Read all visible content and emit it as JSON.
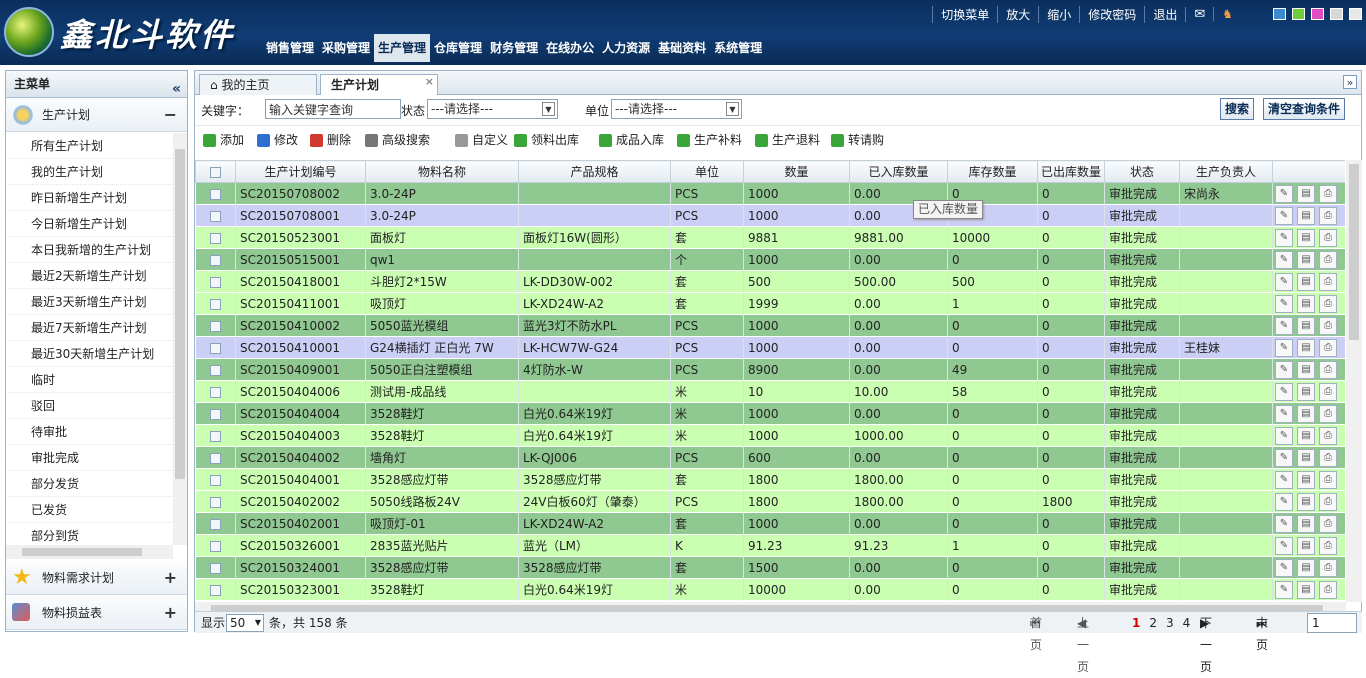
{
  "app": {
    "logo_text": "鑫北斗软件"
  },
  "top_nav": [
    "销售管理",
    "采购管理",
    "生产管理",
    "仓库管理",
    "财务管理",
    "在线办公",
    "人力资源",
    "基础资料",
    "系统管理"
  ],
  "top_utils": {
    "switch_menu": "切换菜单",
    "zoom_in": "放大",
    "zoom_out": "缩小",
    "change_password": "修改密码",
    "logout": "退出"
  },
  "theme_colors": [
    "#3c8ad0",
    "#6ccc3c",
    "#e04cc0",
    "#d8d8d8",
    "#e8e8e8"
  ],
  "sidebar": {
    "title": "主菜单",
    "collapse_glyph": "«",
    "groups": [
      {
        "label": "生产计划",
        "state": "−"
      },
      {
        "label": "物料需求计划",
        "state": "+"
      },
      {
        "label": "物料损益表",
        "state": "+"
      }
    ],
    "items": [
      "所有生产计划",
      "我的生产计划",
      "昨日新增生产计划",
      "今日新增生产计划",
      "本日我新增的生产计划",
      "最近2天新增生产计划",
      "最近3天新增生产计划",
      "最近7天新增生产计划",
      "最近30天新增生产计划",
      "临时",
      "驳回",
      "待审批",
      "审批完成",
      "部分发货",
      "已发货",
      "部分到货"
    ]
  },
  "tabs": [
    "我的主页",
    "生产计划"
  ],
  "search": {
    "keyword_label": "关键字：",
    "keyword_value": "输入关键字查询",
    "status_label": "状态",
    "status_value": "---请选择---",
    "unit_label": "单位",
    "unit_value": "---请选择---",
    "search_btn": "搜索",
    "clear_btn": "清空查询条件"
  },
  "toolbar": [
    {
      "label": "添加",
      "color": "#3aa63a"
    },
    {
      "label": "修改",
      "color": "#2f6fd0"
    },
    {
      "label": "删除",
      "color": "#d03a2f"
    },
    {
      "label": "高级搜索",
      "color": "#777777"
    },
    {
      "label": "自定义",
      "color": "#999999"
    },
    {
      "label": "领料出库",
      "color": "#3aa63a"
    },
    {
      "label": "成品入库",
      "color": "#3aa63a"
    },
    {
      "label": "生产补料",
      "color": "#3aa63a"
    },
    {
      "label": "生产退料",
      "color": "#3aa63a"
    },
    {
      "label": "转请购",
      "color": "#3aa63a"
    }
  ],
  "columns": [
    "生产计划编号",
    "物料名称",
    "产品规格",
    "单位",
    "数量",
    "已入库数量",
    "库存数量",
    "已出库数量",
    "状态",
    "生产负责人"
  ],
  "rows": [
    {
      "c": [
        "SC20150708002",
        "3.0-24P",
        "",
        "PCS",
        "1000",
        "0.00",
        "0",
        "0",
        "审批完成",
        "宋尚永"
      ],
      "t": "g"
    },
    {
      "c": [
        "SC20150708001",
        "3.0-24P",
        "",
        "PCS",
        "1000",
        "0.00",
        "",
        "0",
        "审批完成",
        ""
      ],
      "t": "p"
    },
    {
      "c": [
        "SC20150523001",
        "面板灯",
        "面板灯16W(圆形）",
        "套",
        "9881",
        "9881.00",
        "10000",
        "0",
        "审批完成",
        ""
      ],
      "t": "l"
    },
    {
      "c": [
        "SC20150515001",
        "qw1",
        "",
        "个",
        "1000",
        "0.00",
        "0",
        "0",
        "审批完成",
        ""
      ],
      "t": "g"
    },
    {
      "c": [
        "SC20150418001",
        "斗胆灯2*15W",
        "LK-DD30W-002",
        "套",
        "500",
        "500.00",
        "500",
        "0",
        "审批完成",
        ""
      ],
      "t": "l"
    },
    {
      "c": [
        "SC20150411001",
        "吸顶灯",
        "LK-XD24W-A2",
        "套",
        "1999",
        "0.00",
        "1",
        "0",
        "审批完成",
        ""
      ],
      "t": "l"
    },
    {
      "c": [
        "SC20150410002",
        "5050蓝光模组",
        "蓝光3灯不防水PL",
        "PCS",
        "1000",
        "0.00",
        "0",
        "0",
        "审批完成",
        ""
      ],
      "t": "g"
    },
    {
      "c": [
        "SC20150410001",
        "G24横插灯 正白光 7W",
        "LK-HCW7W-G24",
        "PCS",
        "1000",
        "0.00",
        "0",
        "0",
        "审批完成",
        "王桂妹"
      ],
      "t": "p"
    },
    {
      "c": [
        "SC20150409001",
        "5050正白注塑模组",
        "4灯防水-W",
        "PCS",
        "8900",
        "0.00",
        "49",
        "0",
        "审批完成",
        ""
      ],
      "t": "g"
    },
    {
      "c": [
        "SC20150404006",
        "测试用-成品线",
        "",
        "米",
        "10",
        "10.00",
        "58",
        "0",
        "审批完成",
        ""
      ],
      "t": "l"
    },
    {
      "c": [
        "SC20150404004",
        "3528鞋灯",
        "白光0.64米19灯",
        "米",
        "1000",
        "0.00",
        "0",
        "0",
        "审批完成",
        ""
      ],
      "t": "g"
    },
    {
      "c": [
        "SC20150404003",
        "3528鞋灯",
        "白光0.64米19灯",
        "米",
        "1000",
        "1000.00",
        "0",
        "0",
        "审批完成",
        ""
      ],
      "t": "l"
    },
    {
      "c": [
        "SC20150404002",
        "墙角灯",
        "LK-QJ006",
        "PCS",
        "600",
        "0.00",
        "0",
        "0",
        "审批完成",
        ""
      ],
      "t": "g"
    },
    {
      "c": [
        "SC20150404001",
        "3528感应灯带",
        "3528感应灯带",
        "套",
        "1800",
        "1800.00",
        "0",
        "0",
        "审批完成",
        ""
      ],
      "t": "l"
    },
    {
      "c": [
        "SC20150402002",
        "5050线路板24V",
        "24V白板60灯（肇泰）",
        "PCS",
        "1800",
        "1800.00",
        "0",
        "1800",
        "审批完成",
        ""
      ],
      "t": "l"
    },
    {
      "c": [
        "SC20150402001",
        "吸顶灯-01",
        "LK-XD24W-A2",
        "套",
        "1000",
        "0.00",
        "0",
        "0",
        "审批完成",
        ""
      ],
      "t": "g"
    },
    {
      "c": [
        "SC20150326001",
        "2835蓝光贴片",
        "蓝光（LM）",
        "K",
        "91.23",
        "91.23",
        "1",
        "0",
        "审批完成",
        ""
      ],
      "t": "l"
    },
    {
      "c": [
        "SC20150324001",
        "3528感应灯带",
        "3528感应灯带",
        "套",
        "1500",
        "0.00",
        "0",
        "0",
        "审批完成",
        ""
      ],
      "t": "g"
    },
    {
      "c": [
        "SC20150323001",
        "3528鞋灯",
        "白光0.64米19灯",
        "米",
        "10000",
        "0.00",
        "0",
        "0",
        "审批完成",
        ""
      ],
      "t": "l"
    }
  ],
  "tooltip": "已入库数量",
  "footer": {
    "show": "显示",
    "page_size": "50",
    "count_text": "条，共 158 条",
    "first": "首页",
    "prev": "上一页",
    "pages": [
      "1",
      "2",
      "3",
      "4"
    ],
    "next": "下一页",
    "last": "末页",
    "page_input": "1"
  }
}
